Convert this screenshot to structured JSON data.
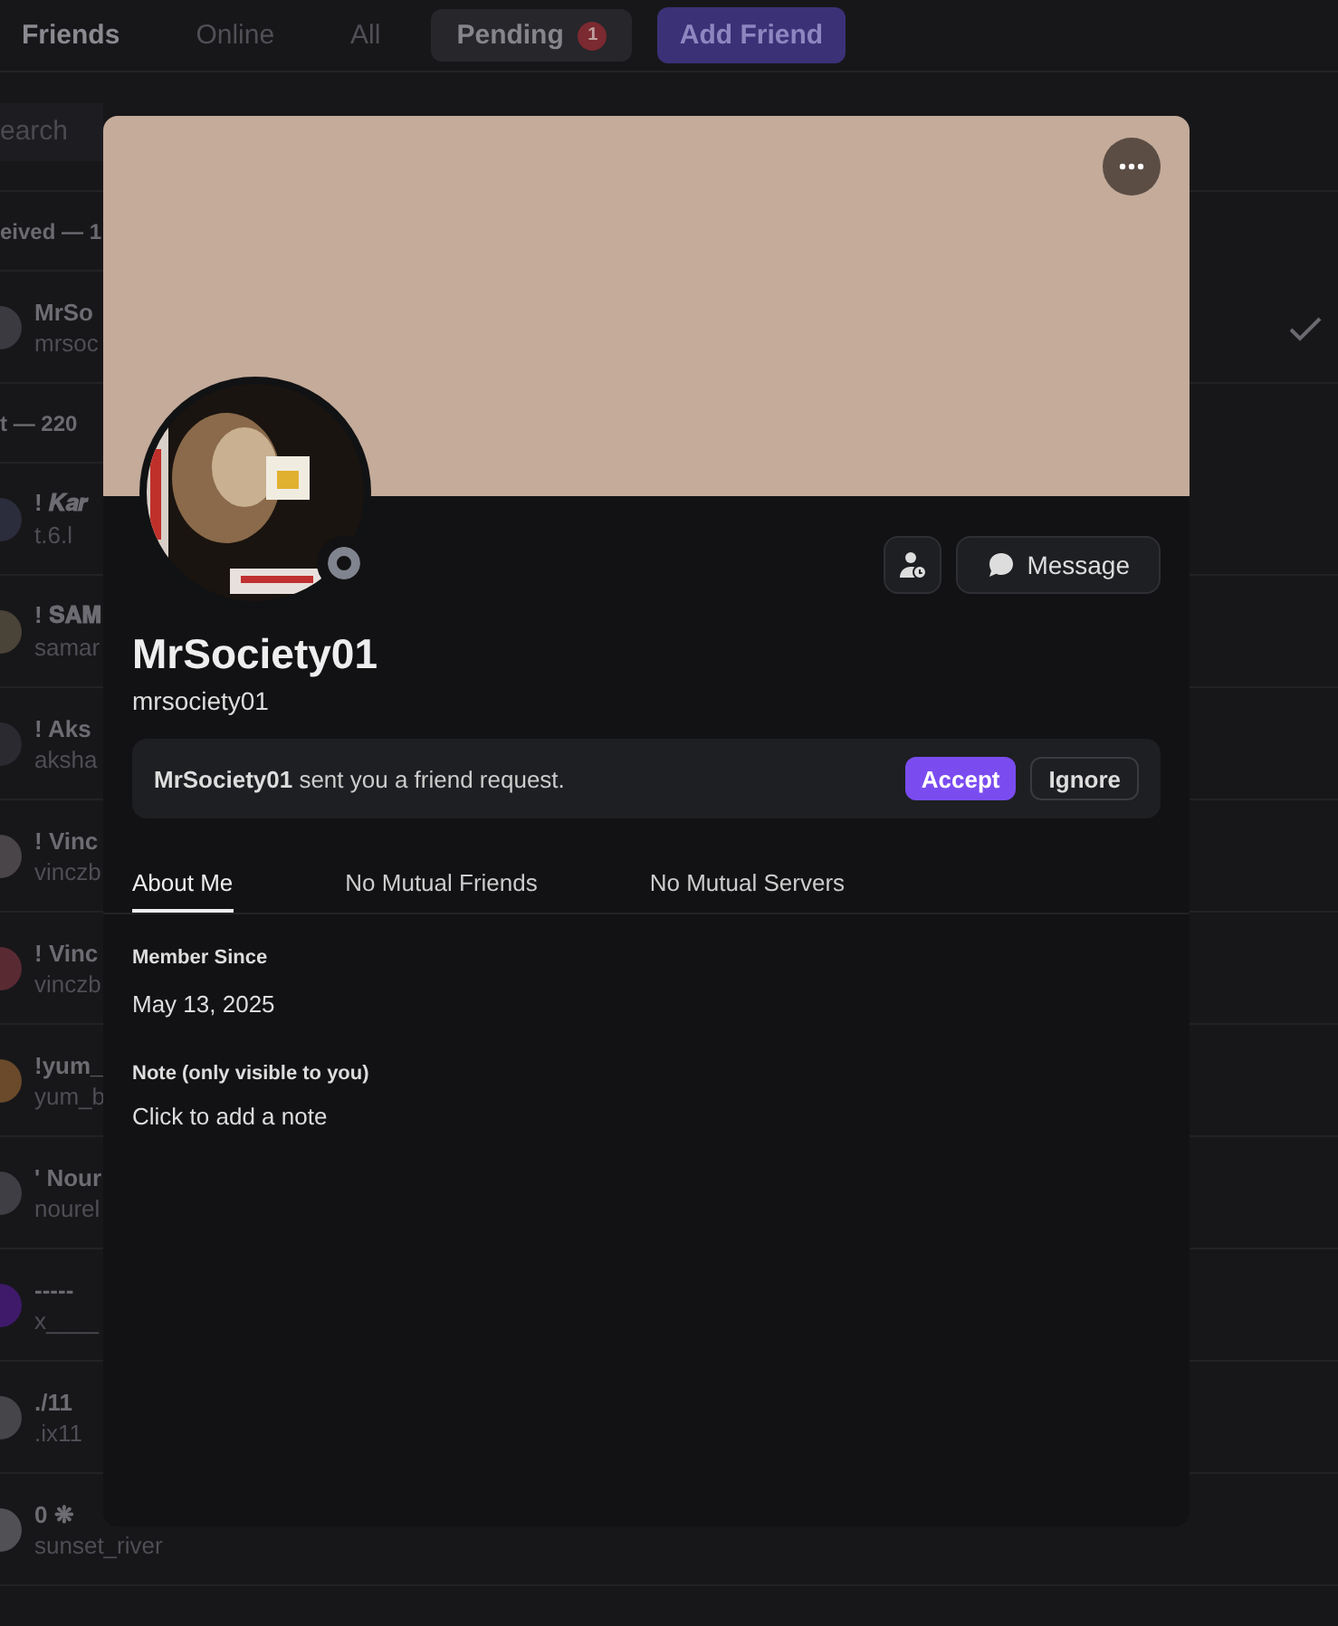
{
  "top_bar": {
    "title": "Friends",
    "tabs": [
      {
        "label": "Online",
        "selected": false,
        "kind": "tab"
      },
      {
        "label": "All",
        "selected": false,
        "kind": "tab"
      },
      {
        "label": "Pending",
        "selected": true,
        "kind": "tab",
        "badge": "1"
      },
      {
        "label": "Add Friend",
        "selected": false,
        "kind": "add"
      }
    ]
  },
  "search": {
    "placeholder": "earch"
  },
  "received_header": "eived — 1",
  "received": [
    {
      "name": "MrSo",
      "username": "mrsoc",
      "color": "#3a3a40"
    }
  ],
  "sent_header": "t — 220",
  "sent": [
    {
      "name": "! 𝑲𝒂𝒓",
      "username": "t.6.l",
      "color": "#2c2d3c"
    },
    {
      "name": "! 𝐒𝐀𝐌",
      "username": "samar",
      "color": "#4a4338"
    },
    {
      "name": "! Aks",
      "username": "aksha",
      "color": "#2a2a30"
    },
    {
      "name": "! Vinc",
      "username": "vinczb",
      "color": "#4a4548"
    },
    {
      "name": "! Vinc",
      "username": "vinczb",
      "color": "#5a2a33"
    },
    {
      "name": "!yum_",
      "username": "yum_b",
      "color": "#6a4a2a"
    },
    {
      "name": "' Nour",
      "username": "nourel",
      "color": "#3e3e44"
    },
    {
      "name": "-----",
      "username": "x____",
      "color": "#3f1a6a"
    },
    {
      "name": "./11",
      "username": ".ix11",
      "color": "#45454a"
    },
    {
      "name": "0 ❋",
      "username": "sunset_river",
      "color": "#505055"
    }
  ],
  "profile": {
    "display_name": "MrSociety01",
    "username": "mrsociety01",
    "message_button": "Message",
    "request": {
      "text": "**MrSociety01** sent you a friend request.",
      "accept": "Accept",
      "ignore": "Ignore"
    },
    "tabs": [
      {
        "label": "About Me",
        "selected": true
      },
      {
        "label": "No Mutual Friends",
        "selected": false
      },
      {
        "label": "No Mutual Servers",
        "selected": false
      }
    ],
    "member_since_label": "Member Since",
    "member_since": "May 13, 2025",
    "note_label": "Note (only visible to you)",
    "note_placeholder": "Click to add a note"
  }
}
